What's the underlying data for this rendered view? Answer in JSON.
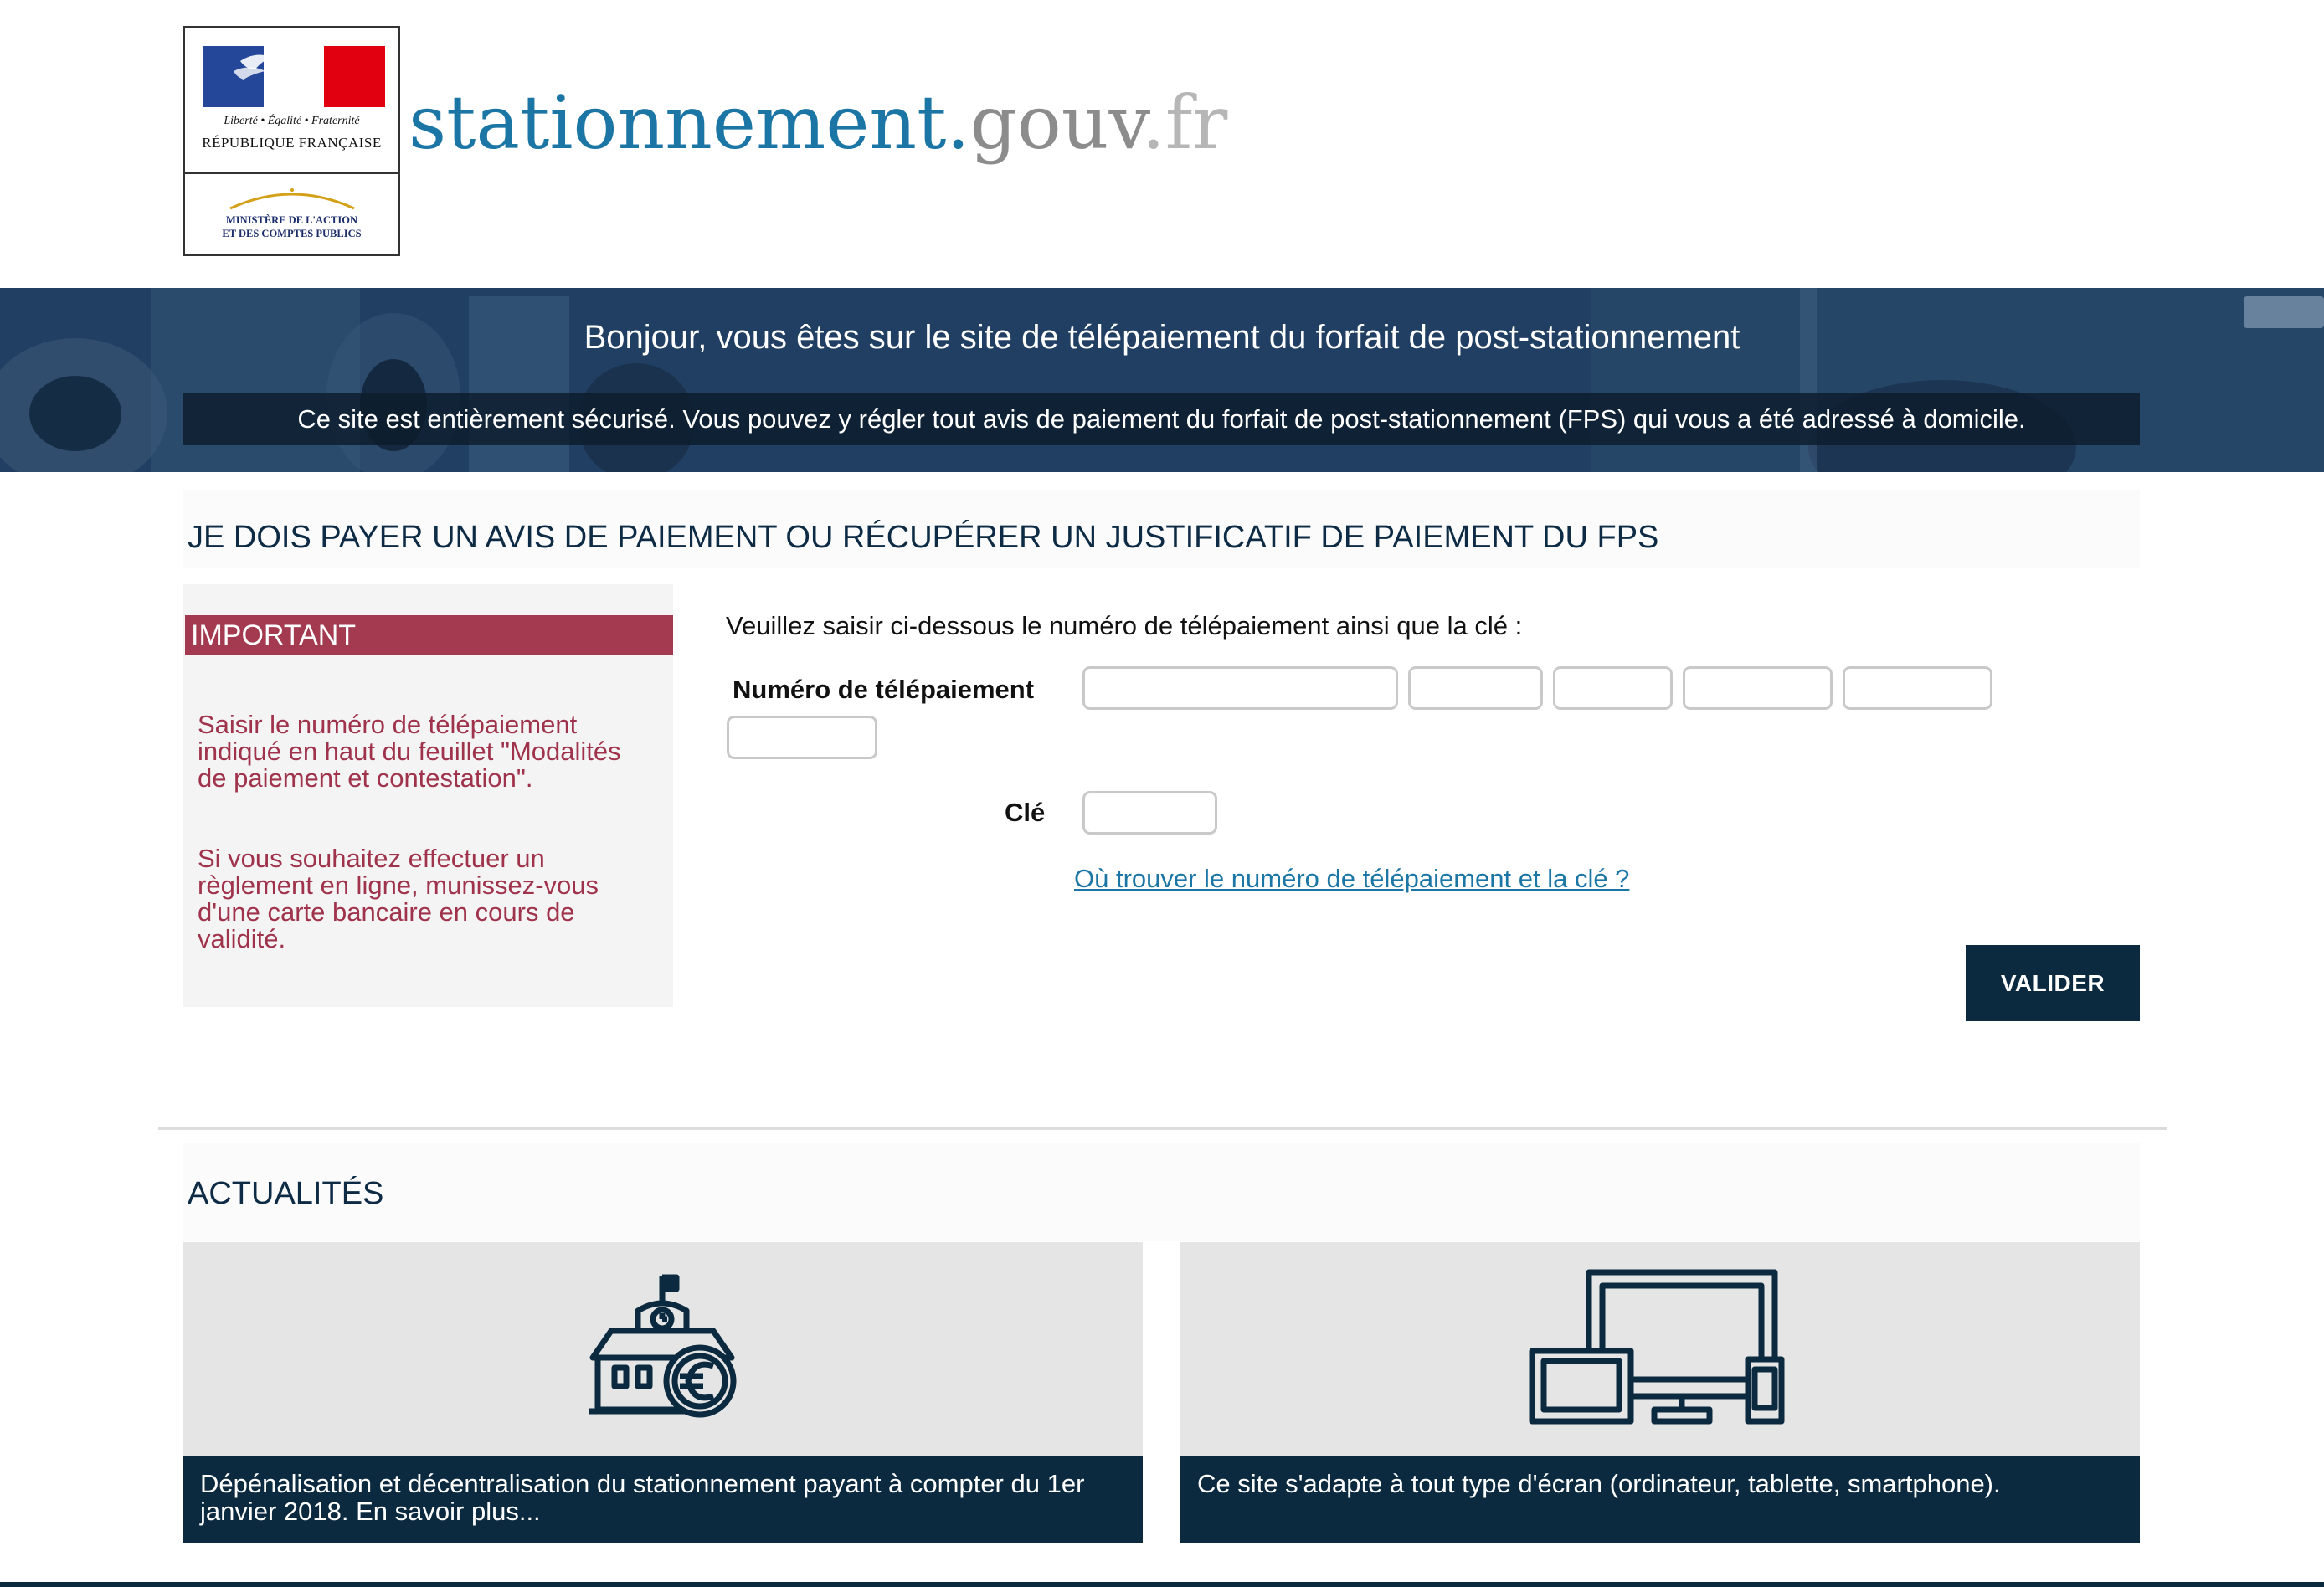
{
  "header": {
    "logo": {
      "devise": "Liberté • Égalité • Fraternité",
      "republique": "RÉPUBLIQUE FRANÇAISE",
      "ministere": "MINISTÈRE DE L'ACTION\nET DES COMPTES PUBLICS"
    },
    "site_title": {
      "main": "stationnement",
      "dot1": ".",
      "gouv": "gouv",
      "dot2": ".",
      "fr": "fr"
    }
  },
  "banner": {
    "title": "Bonjour, vous êtes sur le site de télépaiement du forfait de post-stationnement",
    "security_text": "Ce site est entièrement sécurisé. Vous pouvez y régler tout avis de paiement du forfait de post-stationnement (FPS) qui vous a été adressé à domicile."
  },
  "payment_section": {
    "heading": "JE DOIS PAYER UN AVIS DE PAIEMENT OU RÉCUPÉRER UN JUSTIFICATIF DE PAIEMENT DU FPS",
    "important": {
      "title": "IMPORTANT",
      "paragraph_1": "Saisir le numéro de télépaiement indiqué en haut du feuillet \"Modalités de paiement et contestation\".",
      "paragraph_2": "Si vous souhaitez effectuer un règlement en ligne, munissez-vous d'une carte bancaire en cours de validité."
    },
    "form": {
      "intro": "Veuillez saisir ci-dessous le numéro de télépaiement ainsi que la clé :",
      "numero_label": "Numéro de télépaiement",
      "numero_fields": [
        "",
        "",
        "",
        "",
        "",
        ""
      ],
      "cle_label": "Clé",
      "cle_value": "",
      "help_link": "Où trouver le numéro de télépaiement et la clé ?",
      "submit_label": "VALIDER"
    }
  },
  "news_section": {
    "heading": "ACTUALITÉS",
    "cards": [
      {
        "icon": "town-hall-euro-icon",
        "caption": "Dépénalisation et décentralisation du stationnement payant à compter du 1er janvier 2018. En savoir plus..."
      },
      {
        "icon": "devices-icon",
        "caption": "Ce site s'adapte à tout type d'écran (ordinateur, tablette, smartphone)."
      }
    ]
  },
  "colors": {
    "navy": "#0b2a40",
    "accent_red": "#a43a50",
    "link_blue": "#1b76a5",
    "flag_blue": "#24479a",
    "flag_red": "#e1000f"
  }
}
